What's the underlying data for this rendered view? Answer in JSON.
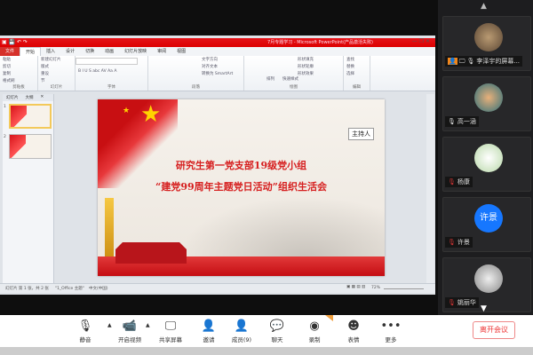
{
  "ppt": {
    "window_title": "7月专题学习 - Microsoft PowerPoint(产品激活失败)",
    "tabs": [
      "文件",
      "开始",
      "插入",
      "设计",
      "切换",
      "动画",
      "幻灯片放映",
      "审阅",
      "视图"
    ],
    "groups": [
      {
        "label": "剪贴板",
        "items": [
          "粘贴",
          "剪切",
          "复制",
          "格式刷"
        ]
      },
      {
        "label": "幻灯片",
        "items": [
          "新建幻灯片",
          "版式",
          "重设",
          "节"
        ]
      },
      {
        "label": "字体",
        "items": [
          "B  I  U  S  abc  AV  Aa  A"
        ]
      },
      {
        "label": "段落",
        "items": [
          "文字方向",
          "对齐文本",
          "转换为 SmartArt"
        ]
      },
      {
        "label": "绘图",
        "items": [
          "排列",
          "快速样式",
          "形状填充",
          "形状轮廓",
          "形状效果"
        ]
      },
      {
        "label": "编辑",
        "items": [
          "查找",
          "替换",
          "选择"
        ]
      }
    ],
    "thumb_tabs": [
      "幻灯片",
      "大纲"
    ],
    "thumb_numbers": [
      "1",
      "2"
    ],
    "slide": {
      "line1": "研究生第一党支部19级党小组",
      "line2": "“建党99周年主题党日活动”组织生活会"
    },
    "status": {
      "slide_count": "幻灯片 第 1 张，共 2 张",
      "theme": "\"1_Office 主题\"",
      "language": "中文(中国)",
      "zoom": "72%"
    },
    "tooltip": "主持人"
  },
  "participants": [
    {
      "name": "李泽宇的屏幕...",
      "mic": "on",
      "host": true,
      "avatar_color": "#8a6f52"
    },
    {
      "name": "高一涵",
      "mic": "on",
      "avatar_color": "#2d6f7a"
    },
    {
      "name": "杨康",
      "mic": "muted",
      "avatar_color": "#d8e6c8"
    },
    {
      "name": "许景",
      "mic": "muted",
      "avatar_text": "许景",
      "avatar_color": "#1677ff"
    },
    {
      "name": "姚丽华",
      "mic": "muted",
      "avatar_color": "#bbbbbb"
    }
  ],
  "toolbar": {
    "items": [
      {
        "label": "静音",
        "icon": "microphone-icon"
      },
      {
        "label": "开启视频",
        "icon": "video-off-icon"
      },
      {
        "label": "共享屏幕",
        "icon": "share-screen-icon"
      },
      {
        "label": "邀请",
        "icon": "invite-icon"
      },
      {
        "label": "成员(9)",
        "icon": "members-icon"
      },
      {
        "label": "聊天",
        "icon": "chat-icon"
      },
      {
        "label": "录制",
        "icon": "record-icon"
      },
      {
        "label": "表情",
        "icon": "emoji-icon"
      },
      {
        "label": "更多",
        "icon": "more-icon"
      }
    ],
    "leave": "离开会议"
  },
  "colors": {
    "accent_red": "#d62020",
    "leave_red": "#e33333",
    "avatar_blue": "#1677ff"
  }
}
